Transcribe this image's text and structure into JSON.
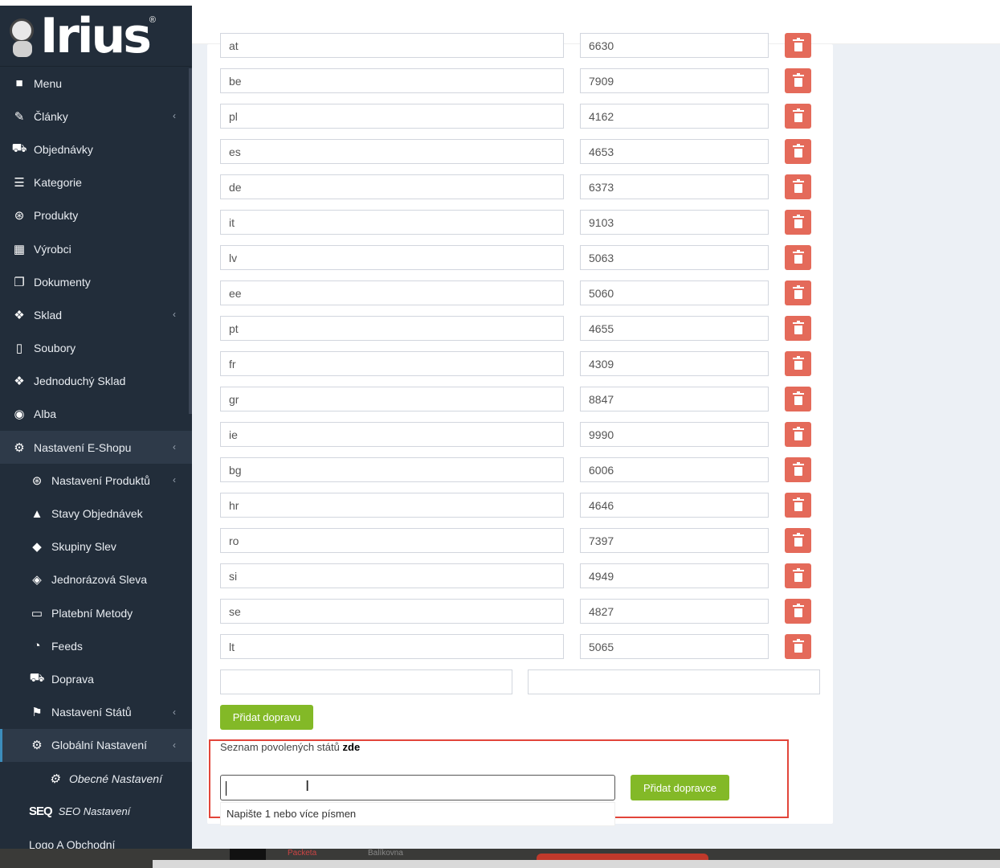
{
  "brand": {
    "logo_text": "Irius",
    "registered": "®"
  },
  "sidebar": {
    "items": [
      {
        "label": "Menu",
        "icon": "folder-icon",
        "chevron": false,
        "level": 0
      },
      {
        "label": "Články",
        "icon": "pencil-icon",
        "chevron": true,
        "level": 0
      },
      {
        "label": "Objednávky",
        "icon": "cart-icon",
        "chevron": false,
        "level": 0
      },
      {
        "label": "Kategorie",
        "icon": "list-icon",
        "chevron": false,
        "level": 0
      },
      {
        "label": "Produkty",
        "icon": "aperture-icon",
        "chevron": false,
        "level": 0
      },
      {
        "label": "Výrobci",
        "icon": "building-icon",
        "chevron": false,
        "level": 0
      },
      {
        "label": "Dokumenty",
        "icon": "copy-icon",
        "chevron": false,
        "level": 0
      },
      {
        "label": "Sklad",
        "icon": "dropbox-icon",
        "chevron": true,
        "level": 0
      },
      {
        "label": "Soubory",
        "icon": "file-icon",
        "chevron": false,
        "level": 0
      },
      {
        "label": "Jednoduchý Sklad",
        "icon": "dropbox-icon",
        "chevron": false,
        "level": 0
      },
      {
        "label": "Alba",
        "icon": "camera-icon",
        "chevron": false,
        "level": 0
      },
      {
        "label": "Nastavení E-Shopu",
        "icon": "cogs-icon",
        "chevron": true,
        "level": 0,
        "state": "active"
      },
      {
        "label": "Nastavení Produktů",
        "icon": "aperture-icon",
        "chevron": true,
        "level": 1
      },
      {
        "label": "Stavy Objednávek",
        "icon": "bell-icon",
        "chevron": false,
        "level": 1
      },
      {
        "label": "Skupiny Slev",
        "icon": "tag-icon",
        "chevron": false,
        "level": 1
      },
      {
        "label": "Jednorázová Sleva",
        "icon": "tags-icon",
        "chevron": false,
        "level": 1
      },
      {
        "label": "Platební Metody",
        "icon": "credit-card-icon",
        "chevron": false,
        "level": 1
      },
      {
        "label": "Feeds",
        "icon": "rss-icon",
        "chevron": false,
        "level": 1
      },
      {
        "label": "Doprava",
        "icon": "truck-icon",
        "chevron": false,
        "level": 1
      },
      {
        "label": "Nastavení Států",
        "icon": "flag-icon",
        "chevron": true,
        "level": 1
      },
      {
        "label": "Globální Nastavení",
        "icon": "gear-icon",
        "chevron": true,
        "level": 1,
        "state": "current"
      },
      {
        "label": "Obecné Nastavení",
        "icon": "gear-icon",
        "chevron": false,
        "level": 2
      },
      {
        "label": "SEO Nastavení",
        "icon": "seo-icon",
        "icon_text": "SEQ",
        "chevron": false,
        "level": 1
      },
      {
        "label": "Logo A Obchodní",
        "icon": "",
        "chevron": false,
        "level": 1
      }
    ]
  },
  "shipping_rows": [
    {
      "code": "at",
      "value": "6630"
    },
    {
      "code": "be",
      "value": "7909"
    },
    {
      "code": "pl",
      "value": "4162"
    },
    {
      "code": "es",
      "value": "4653"
    },
    {
      "code": "de",
      "value": "6373"
    },
    {
      "code": "it",
      "value": "9103"
    },
    {
      "code": "lv",
      "value": "5063"
    },
    {
      "code": "ee",
      "value": "5060"
    },
    {
      "code": "pt",
      "value": "4655"
    },
    {
      "code": "fr",
      "value": "4309"
    },
    {
      "code": "gr",
      "value": "8847"
    },
    {
      "code": "ie",
      "value": "9990"
    },
    {
      "code": "bg",
      "value": "6006"
    },
    {
      "code": "hr",
      "value": "4646"
    },
    {
      "code": "ro",
      "value": "7397"
    },
    {
      "code": "si",
      "value": "4949"
    },
    {
      "code": "se",
      "value": "4827"
    },
    {
      "code": "lt",
      "value": "5065"
    }
  ],
  "new_row": {
    "code": "",
    "value": ""
  },
  "add_shipping_label": "Přidat dopravu",
  "allowed": {
    "label": "Seznam povolených států",
    "link": "zde",
    "input_value": "",
    "hint": "Napište 1 nebo více písmen",
    "add_carrier_label": "Přidat dopravce"
  },
  "taskbar": {
    "item1": "Packeta",
    "item2": "Balíkovna"
  },
  "colors": {
    "sidebar": "#222d3a",
    "delete": "#e46a5a",
    "green": "#83b927",
    "highlight": "#e2453a"
  }
}
